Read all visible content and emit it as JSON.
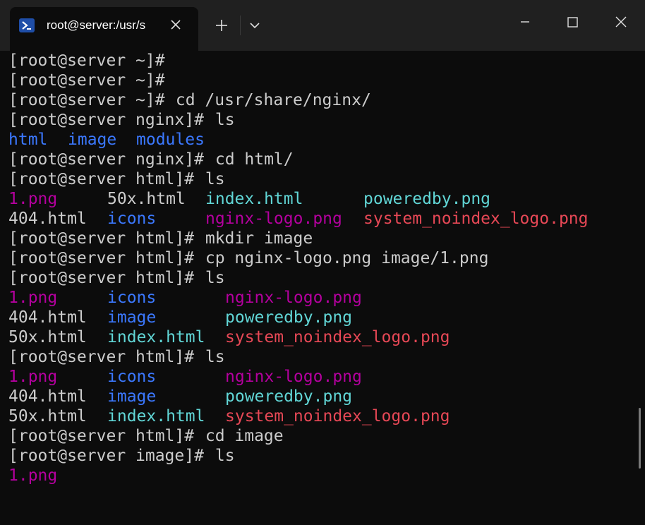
{
  "window": {
    "tab_title": "root@server:/usr/s"
  },
  "icons": {
    "tab_icon": "powershell-icon",
    "close_tab": "close-icon",
    "new_tab": "plus-icon",
    "dropdown": "chevron-down-icon",
    "minimize": "minimize-icon",
    "maximize": "maximize-icon",
    "close_window": "close-icon"
  },
  "colors": {
    "background": "#0c0c0c",
    "titlebar": "#202020",
    "text": "#cccccc",
    "directory": "#3b78ff",
    "image_file": "#b4009e",
    "text_cyan": "#61d6d6",
    "image_red": "#e74856"
  },
  "terminal": {
    "lines": [
      {
        "prompt": "[root@server ~]#",
        "command": ""
      },
      {
        "prompt": "[root@server ~]#",
        "command": ""
      },
      {
        "prompt": "[root@server ~]#",
        "command": " cd /usr/share/nginx/"
      },
      {
        "prompt": "[root@server nginx]#",
        "command": " ls"
      },
      {
        "c1": "html",
        "c2": "image",
        "c3": "modules"
      },
      {
        "prompt": "[root@server nginx]#",
        "command": " cd html/"
      },
      {
        "prompt": "[root@server html]#",
        "command": " ls"
      },
      {
        "c1": "1.png",
        "c2": "50x.html",
        "c3": "index.html",
        "c4": "poweredby.png"
      },
      {
        "c1": "404.html",
        "c2": "icons",
        "c3": "nginx-logo.png",
        "c4": "system_noindex_logo.png"
      },
      {
        "prompt": "[root@server html]#",
        "command": " mkdir image"
      },
      {
        "prompt": "[root@server html]#",
        "command": " cp nginx-logo.png image/1.png"
      },
      {
        "prompt": "[root@server html]#",
        "command": " ls"
      },
      {
        "c1": "1.png",
        "c2": "icons",
        "c3": "nginx-logo.png"
      },
      {
        "c1": "404.html",
        "c2": "image",
        "c3": "poweredby.png"
      },
      {
        "c1": "50x.html",
        "c2": "index.html",
        "c3": "system_noindex_logo.png"
      },
      {
        "prompt": "[root@server html]#",
        "command": " ls"
      },
      {
        "c1": "1.png",
        "c2": "icons",
        "c3": "nginx-logo.png"
      },
      {
        "c1": "404.html",
        "c2": "image",
        "c3": "poweredby.png"
      },
      {
        "c1": "50x.html",
        "c2": "index.html",
        "c3": "system_noindex_logo.png"
      },
      {
        "prompt": "[root@server html]#",
        "command": " cd image"
      },
      {
        "prompt": "[root@server image]#",
        "command": " ls"
      },
      {
        "c1": "1.png"
      }
    ]
  }
}
